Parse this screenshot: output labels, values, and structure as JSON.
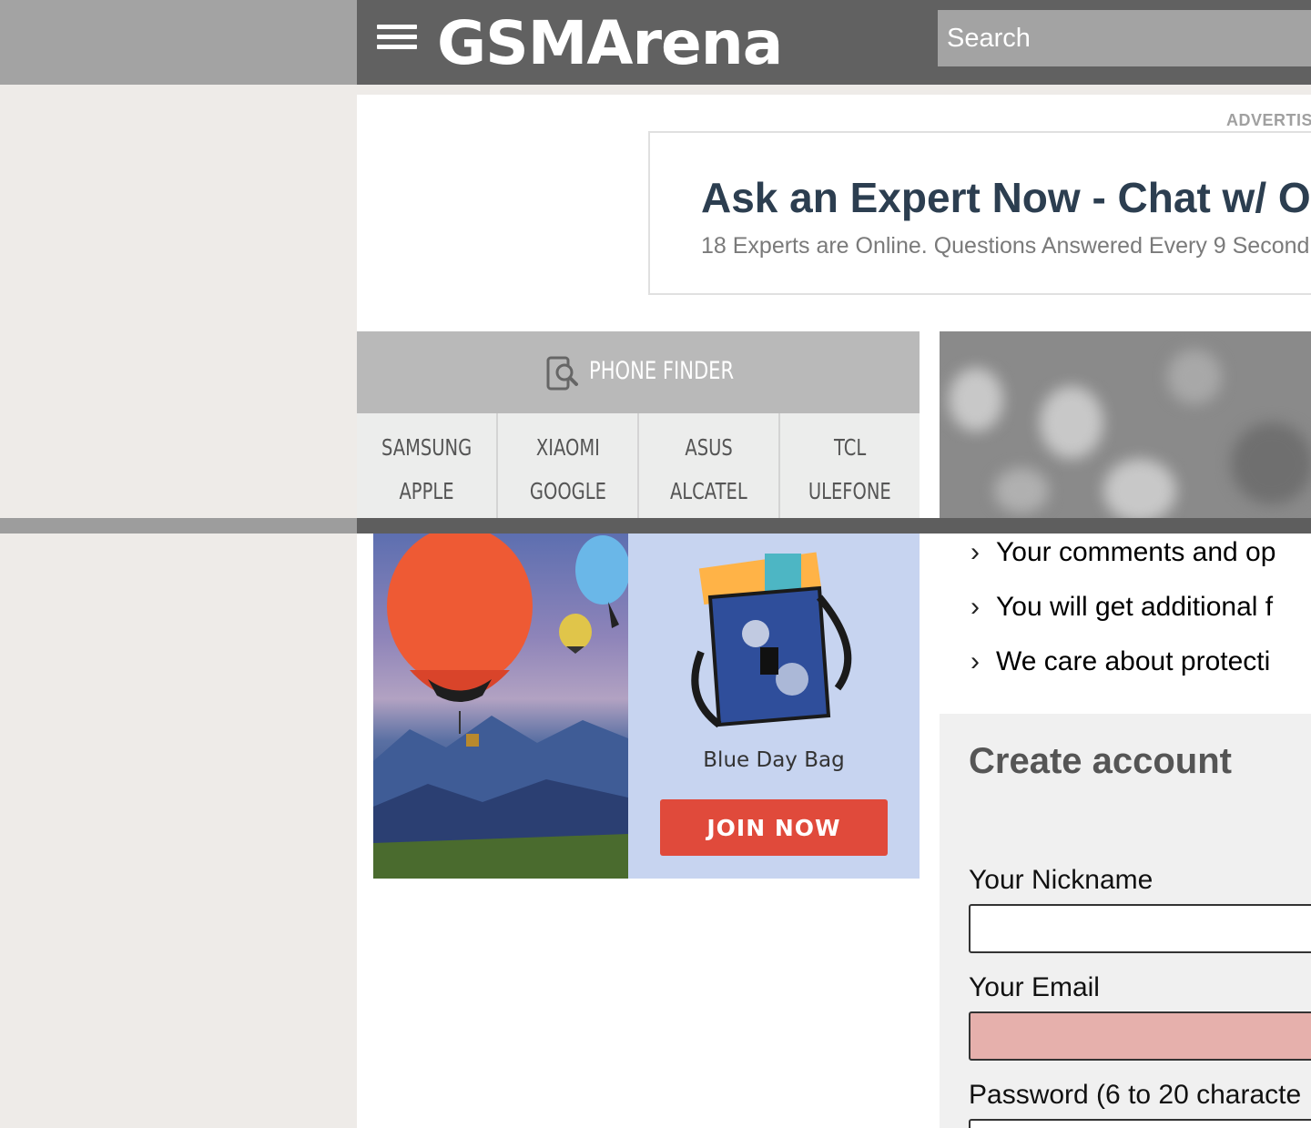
{
  "header": {
    "logo_text": "GSMArena",
    "search_placeholder": "Search"
  },
  "ad": {
    "label": "ADVERTIS",
    "title": "Ask an Expert Now - Chat w/ Onli",
    "subtitle": "18 Experts are Online. Questions Answered Every 9 Second"
  },
  "phone_finder": {
    "title": "PHONE FINDER",
    "brands": [
      [
        "SAMSUNG",
        "APPLE"
      ],
      [
        "XIAOMI",
        "GOOGLE"
      ],
      [
        "ASUS",
        "ALCATEL"
      ],
      [
        "TCL",
        "ULEFONE"
      ]
    ]
  },
  "banner": {
    "product": "Blue Day Bag",
    "cta": "JOIN NOW"
  },
  "benefits": [
    "Your comments and op",
    "You will get additional f",
    "We care about protecti"
  ],
  "account": {
    "title": "Create account",
    "nickname_label": "Your Nickname",
    "email_label": "Your Email",
    "password_label": "Password (6 to 20 characte"
  }
}
